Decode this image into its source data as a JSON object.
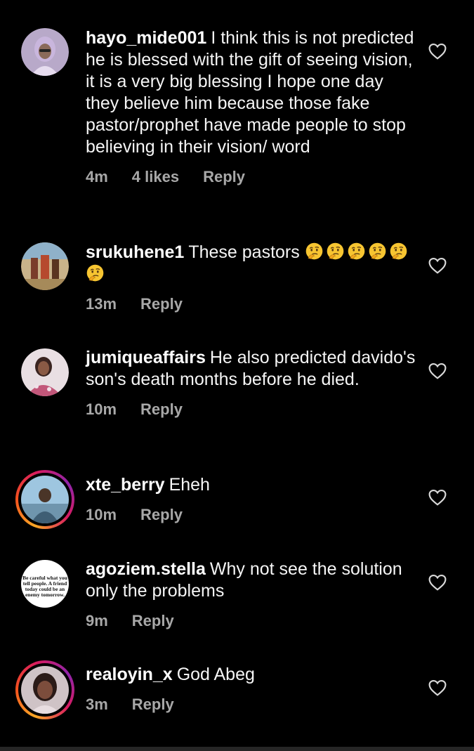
{
  "comments": [
    {
      "username": "hayo_mide001",
      "text": "I think this is not predicted he is blessed with the gift of seeing vision, it is a very big blessing I hope one day they believe him because those fake pastor/prophet have made people to stop believing in their vision/ word",
      "time": "4m",
      "likes": "4 likes",
      "reply": "Reply",
      "story_ring": false
    },
    {
      "username": "srukuhene1",
      "text": "These pastors",
      "emojis": [
        "thinking-face-emoji",
        "thinking-face-emoji",
        "thinking-face-emoji",
        "thinking-face-emoji",
        "thinking-face-emoji",
        "thinking-face-emoji"
      ],
      "time": "13m",
      "reply": "Reply",
      "story_ring": false
    },
    {
      "username": "jumiqueaffairs",
      "text": "He also predicted davido's son's death months before he died.",
      "time": "10m",
      "reply": "Reply",
      "story_ring": false
    },
    {
      "username": "xte_berry",
      "text": "Eheh",
      "time": "10m",
      "reply": "Reply",
      "story_ring": true
    },
    {
      "username": "agoziem.stella",
      "text": "Why not see the solution only the problems",
      "time": "9m",
      "reply": "Reply",
      "story_ring": false,
      "avatar_text": "Be careful what you tell people. A friend today could be an enemy tomorrow."
    },
    {
      "username": "realoyin_x",
      "text": "God Abeg",
      "time": "3m",
      "reply": "Reply",
      "story_ring": true
    }
  ],
  "icons": {
    "like": "heart-outline-icon",
    "emoji": "thinking-face-emoji"
  },
  "colors": {
    "background": "#000000",
    "text": "#f5f5f5",
    "meta": "#a8a8a8",
    "ring_gradient": [
      "#f9a825",
      "#f4511e",
      "#d81b60",
      "#8e24aa"
    ]
  }
}
